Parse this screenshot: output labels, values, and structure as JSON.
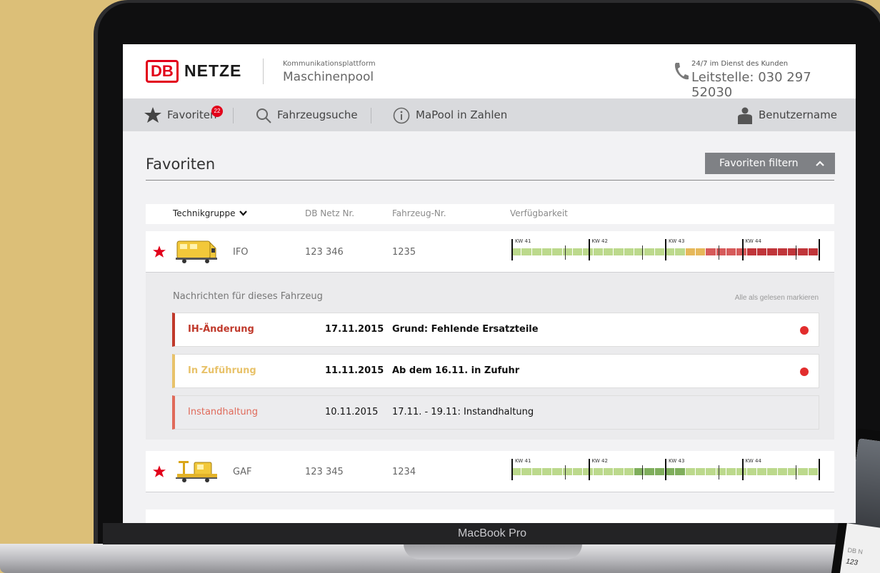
{
  "laptop": {
    "brand_label": "MacBook Pro"
  },
  "phone": {
    "line1": "DB N",
    "line2": "123"
  },
  "header": {
    "logo_db": "DB",
    "logo_netze": "NETZE",
    "platform_small": "Kommunikationsplattform",
    "platform_big": "Maschinenpool",
    "hotline_small": "24/7 im Dienst des Kunden",
    "hotline_big": "Leitstelle: 030 297 52030"
  },
  "nav": {
    "favorites_label": "Favoriten",
    "favorites_badge": "22",
    "search_label": "Fahrzeugsuche",
    "stats_label": "MaPool in Zahlen",
    "user_label": "Benutzername"
  },
  "page": {
    "title": "Favoriten",
    "filter_button": "Favoriten filtern"
  },
  "columns": {
    "technikgruppe": "Technikgruppe",
    "db_netz_nr": "DB Netz Nr.",
    "fahrzeug_nr": "Fahrzeug-Nr.",
    "verfuegbarkeit": "Verfügbarkeit"
  },
  "weeks": [
    "KW 41",
    "KW 42",
    "KW 43",
    "KW 44"
  ],
  "colors": {
    "available": "#bcd98c",
    "available_dark": "#7fae5c",
    "partial": "#e6b85a",
    "warn": "#d65a5a",
    "blocked": "#c0353a",
    "accent_red": "#e2001a"
  },
  "vehicles": [
    {
      "group": "IFO",
      "db_nr": "123 346",
      "vehicle_nr": "1235",
      "availability": [
        "a",
        "a",
        "a",
        "a",
        "a",
        "a",
        "a",
        "a",
        "a",
        "a",
        "a",
        "a",
        "a",
        "a",
        "a",
        "a",
        "a",
        "p",
        "p",
        "w",
        "w",
        "w",
        "w",
        "b",
        "b",
        "b",
        "b",
        "b",
        "b",
        "b"
      ]
    },
    {
      "group": "GAF",
      "db_nr": "123 345",
      "vehicle_nr": "1234",
      "availability": [
        "a",
        "a",
        "a",
        "a",
        "a",
        "a",
        "a",
        "a",
        "a",
        "a",
        "a",
        "a",
        "d",
        "d",
        "d",
        "d",
        "d",
        "a",
        "a",
        "a",
        "a",
        "a",
        "a",
        "a",
        "a",
        "a",
        "a",
        "a",
        "a",
        "a"
      ]
    }
  ],
  "messages": {
    "title": "Nachrichten für dieses Fahrzeug",
    "mark_all": "Alle als gelesen markieren",
    "items": [
      {
        "type": "IH-Änderung",
        "date": "17.11.2015",
        "text": "Grund: Fehlende Ersatzteile",
        "color": "#c0392b",
        "unread": true
      },
      {
        "type": "In Zuführung",
        "date": "11.11.2015",
        "text": "Ab dem 16.11. in Zufuhr",
        "color": "#e8c26a",
        "unread": true
      },
      {
        "type": "Instandhaltung",
        "date": "10.11.2015",
        "text": "17.11. - 19.11: Instandhaltung",
        "color": "#e06a5a",
        "unread": false
      }
    ]
  }
}
